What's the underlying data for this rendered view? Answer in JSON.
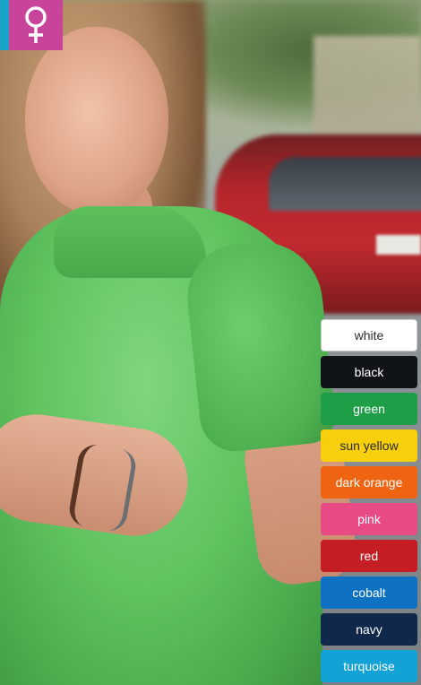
{
  "badge": {
    "icon": "female-symbol-icon",
    "background": "#c8449a",
    "accent": "#1aa3c8"
  },
  "colors": [
    {
      "label": "white",
      "bg": "#ffffff",
      "fg": "#2a2a2a"
    },
    {
      "label": "black",
      "bg": "#101418",
      "fg": "#ffffff"
    },
    {
      "label": "green",
      "bg": "#1e9f47",
      "fg": "#ffffff"
    },
    {
      "label": "sun yellow",
      "bg": "#f7cf0c",
      "fg": "#2a2a2a"
    },
    {
      "label": "dark orange",
      "bg": "#ee6412",
      "fg": "#ffffff"
    },
    {
      "label": "pink",
      "bg": "#e84a86",
      "fg": "#ffffff"
    },
    {
      "label": "red",
      "bg": "#c41d23",
      "fg": "#ffffff"
    },
    {
      "label": "cobalt",
      "bg": "#0e71c1",
      "fg": "#ffffff"
    },
    {
      "label": "navy",
      "bg": "#10294a",
      "fg": "#ffffff"
    },
    {
      "label": "turquoise",
      "bg": "#13a2d6",
      "fg": "#ffffff"
    }
  ]
}
